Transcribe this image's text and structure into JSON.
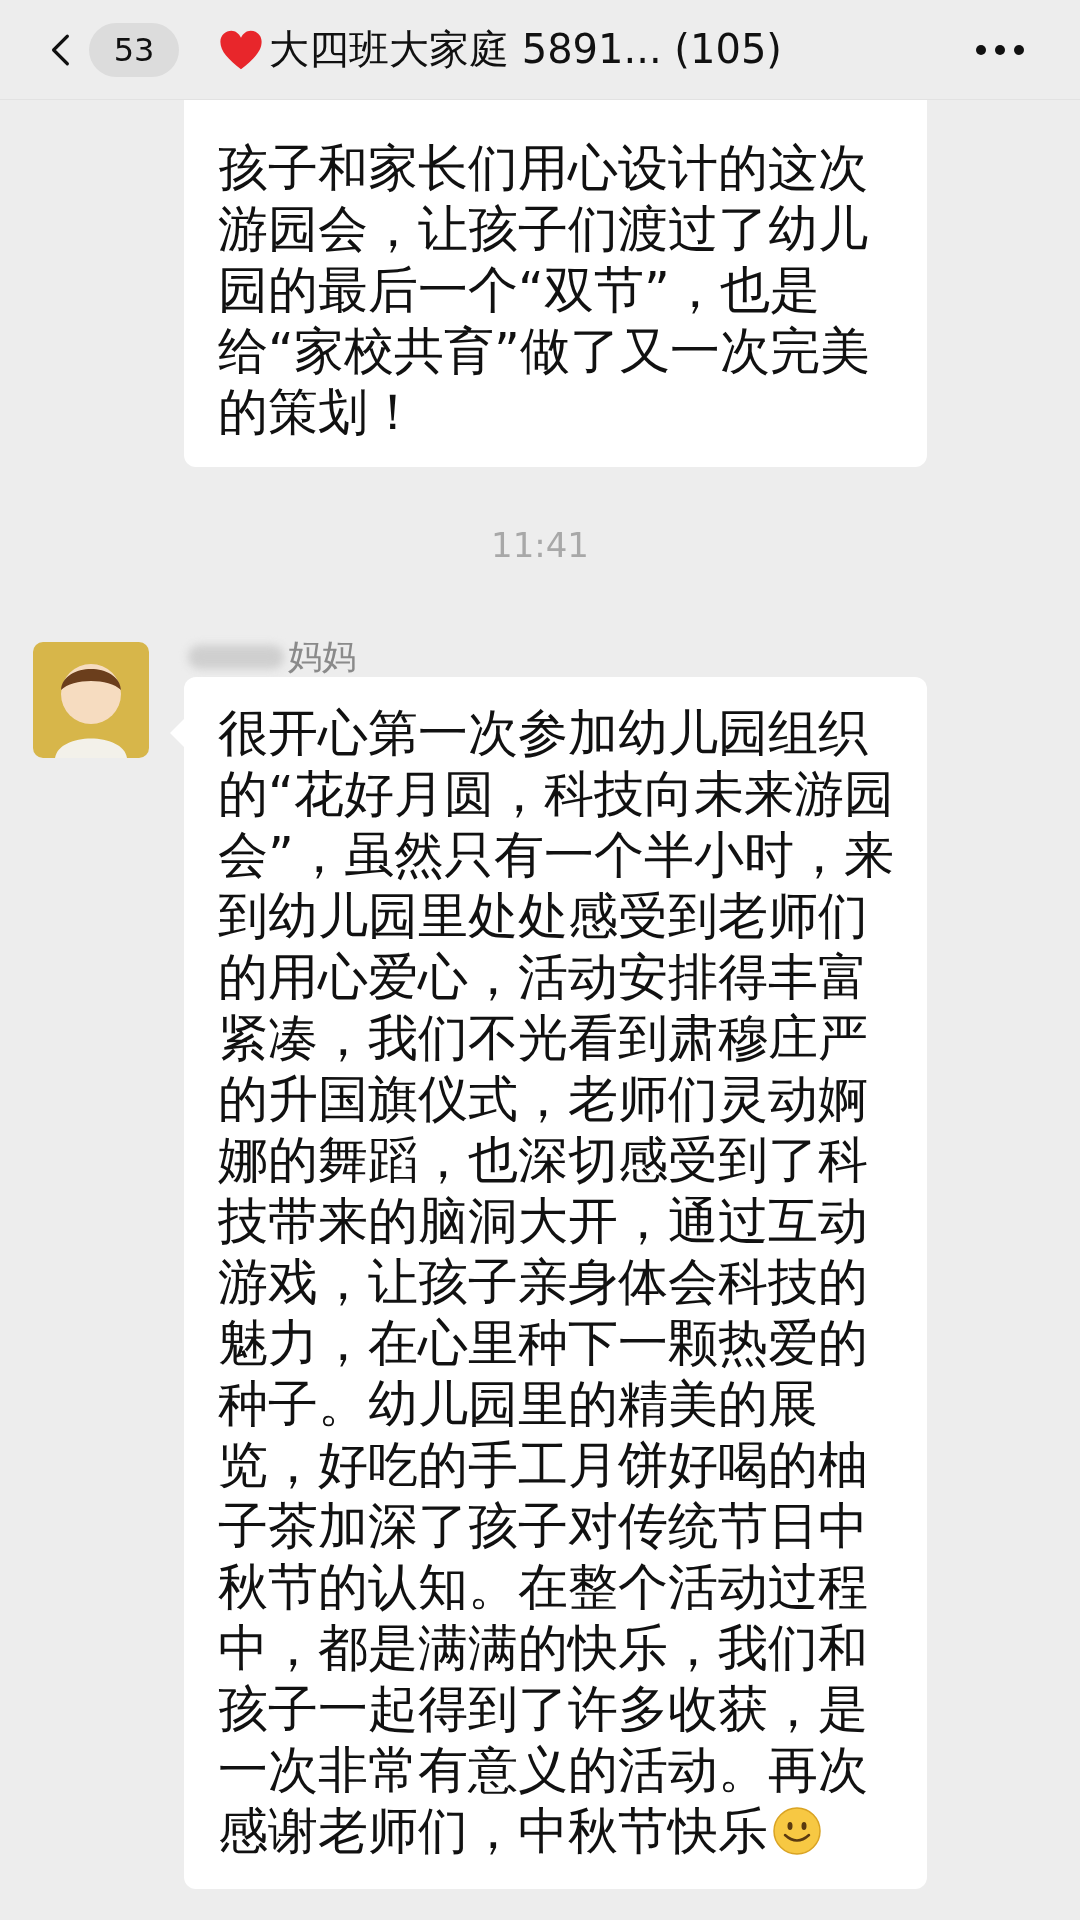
{
  "header": {
    "back_badge": "53",
    "title": "大四班大家庭 5891... (105)"
  },
  "messages": [
    {
      "kind": "text",
      "text": "孩子和家长们用心设计的这次游园会，让孩子们渡过了幼儿园的最后一个“双节”，也是给“家校共育”做了又一次完美的策划！"
    },
    {
      "kind": "timestamp",
      "text": "11:41"
    },
    {
      "kind": "incoming",
      "sender": "妈妈",
      "text": "很开心第一次参加幼儿园组织的“花好月圆，科技向未来游园会”，虽然只有一个半小时，来到幼儿园里处处感受到老师们的用心爱心，活动安排得丰富紧凑，我们不光看到肃穆庄严的升国旗仪式，老师们灵动婀娜的舞蹈，也深切感受到了科技带来的脑洞大开，通过互动游戏，让孩子亲身体会科技的魅力，在心里种下一颗热爱的种子。幼儿园里的精美的展览，好吃的手工月饼好喝的柚子茶加深了孩子对传统节日中秋节的认知。在整个活动过程中，都是满满的快乐，我们和孩子一起得到了许多收获，是一次非常有意义的活动。再次感谢老师们，中秋节快乐",
      "smiley": true
    }
  ]
}
